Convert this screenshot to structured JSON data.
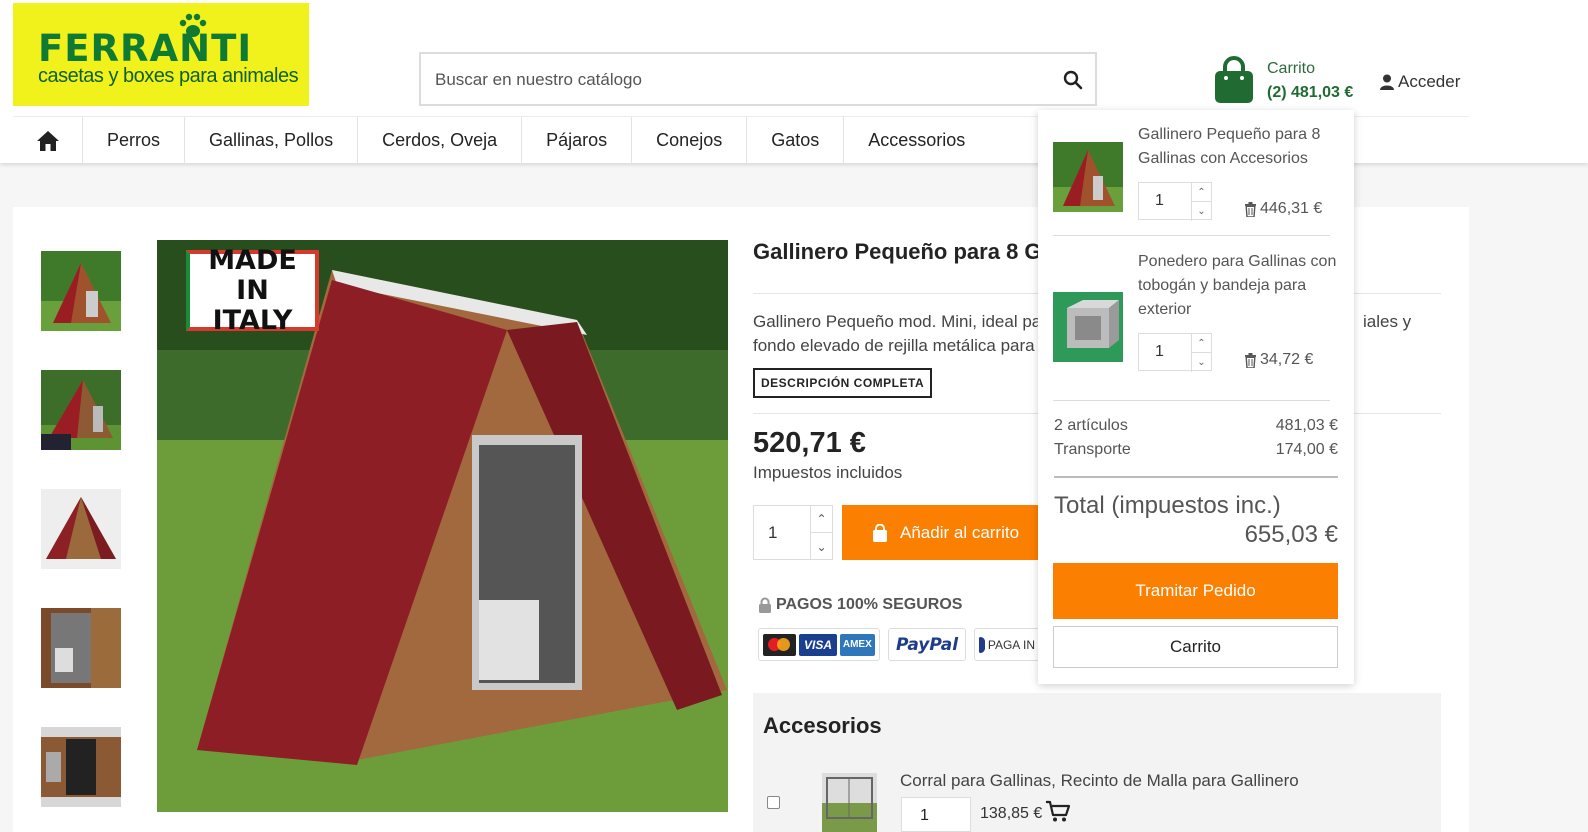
{
  "header": {
    "logo": {
      "brand": "FERRANTI",
      "tagline": "casetas y boxes para animales"
    },
    "search": {
      "placeholder": "Buscar en nuestro catálogo"
    },
    "cart": {
      "label": "Carrito",
      "summary": "(2) 481,03 €"
    },
    "login_label": "Acceder"
  },
  "nav": {
    "items": [
      "Perros",
      "Gallinas, Pollos",
      "Cerdos, Oveja",
      "Pájaros",
      "Conejos",
      "Gatos",
      "Accessorios"
    ]
  },
  "product": {
    "title": "Gallinero Pequeño para 8 G",
    "badge_made_in_italy": "MADE IN ITALY",
    "description_line1": "Gallinero Pequeño mod. Mini, ideal par",
    "description_line1_tail": "iales y",
    "description_line2": "fondo elevado de rejilla metálica para r",
    "full_description_label": "DESCRIPCIÓN COMPLETA",
    "price": "520,71 €",
    "tax_note": "Impuestos incluidos",
    "quantity": "1",
    "add_to_cart_label": "Añadir al carrito",
    "secure_payments_label": "PAGOS 100% SEGUROS",
    "payment_methods": [
      "mastercard",
      "VISA",
      "AMEX",
      "PayPal",
      "PAGA IN"
    ]
  },
  "accessories": {
    "title": "Accesorios",
    "items": [
      {
        "name": "Corral para Gallinas, Recinto de Malla para Gallinero",
        "quantity": "1",
        "price": "138,85 €"
      }
    ]
  },
  "cart_dropdown": {
    "items": [
      {
        "name": "Gallinero Pequeño para 8 Gallinas con Accesorios",
        "quantity": "1",
        "price": "446,31 €"
      },
      {
        "name": "Ponedero para Gallinas con tobogán y bandeja para exterior",
        "quantity": "1",
        "price": "34,72 €"
      }
    ],
    "articles_label": "2 artículos",
    "articles_value": "481,03 €",
    "shipping_label": "Transporte",
    "shipping_value": "174,00 €",
    "total_label": "Total (impuestos inc.)",
    "total_value": "655,03 €",
    "checkout_label": "Tramitar Pedido",
    "cart_label": "Carrito"
  },
  "colors": {
    "accent_orange": "#fb7f00",
    "brand_green": "#1f6b32",
    "logo_yellow": "#f1f21c"
  }
}
